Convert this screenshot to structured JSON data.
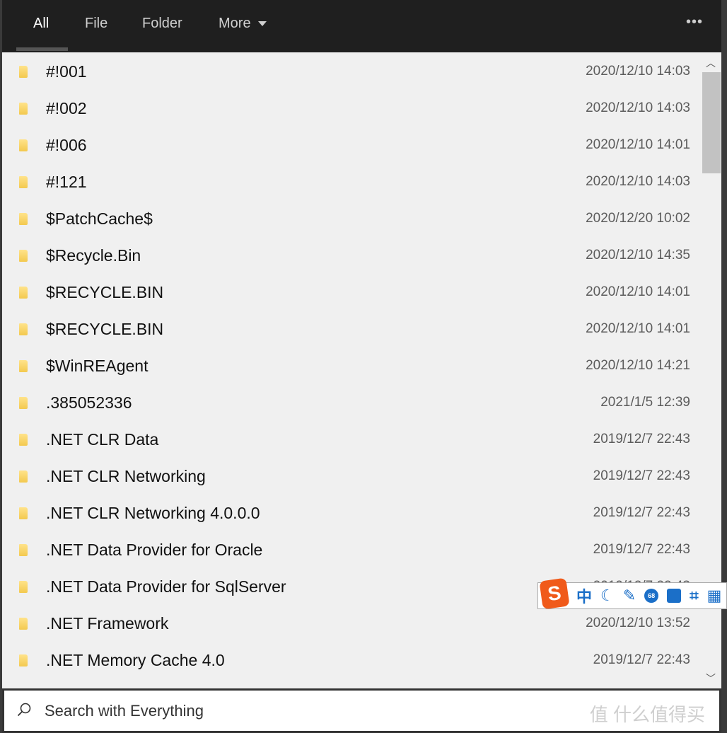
{
  "tabs": [
    {
      "label": "All",
      "active": true
    },
    {
      "label": "File"
    },
    {
      "label": "Folder"
    },
    {
      "label": "More"
    }
  ],
  "more_menu_icon": "ellipsis-icon",
  "rows": [
    {
      "name": "#!001",
      "date": "2020/12/10 14:03"
    },
    {
      "name": "#!002",
      "date": "2020/12/10 14:03"
    },
    {
      "name": "#!006",
      "date": "2020/12/10 14:01"
    },
    {
      "name": "#!121",
      "date": "2020/12/10 14:03"
    },
    {
      "name": "$PatchCache$",
      "date": "2020/12/20 10:02"
    },
    {
      "name": "$Recycle.Bin",
      "date": "2020/12/10 14:35"
    },
    {
      "name": "$RECYCLE.BIN",
      "date": "2020/12/10 14:01"
    },
    {
      "name": "$RECYCLE.BIN",
      "date": "2020/12/10 14:01"
    },
    {
      "name": "$WinREAgent",
      "date": "2020/12/10 14:21"
    },
    {
      "name": ".385052336",
      "date": "2021/1/5 12:39"
    },
    {
      "name": ".NET CLR Data",
      "date": "2019/12/7 22:43"
    },
    {
      "name": ".NET CLR Networking",
      "date": "2019/12/7 22:43"
    },
    {
      "name": ".NET CLR Networking 4.0.0.0",
      "date": "2019/12/7 22:43"
    },
    {
      "name": ".NET Data Provider for Oracle",
      "date": "2019/12/7 22:43"
    },
    {
      "name": ".NET Data Provider for SqlServer",
      "date": "2019/12/7 22:43"
    },
    {
      "name": ".NET Framework",
      "date": "2020/12/10 13:52"
    },
    {
      "name": ".NET Memory Cache 4.0",
      "date": "2019/12/7 22:43"
    }
  ],
  "search": {
    "placeholder": "Search with Everything"
  },
  "watermark": "值 什么值得买",
  "ime": {
    "logo": "S",
    "mode": "中",
    "badge": "68"
  },
  "colors": {
    "folder": "#f3c94f",
    "topbar": "#1f1f1f",
    "ime_accent": "#1b6fc8"
  }
}
